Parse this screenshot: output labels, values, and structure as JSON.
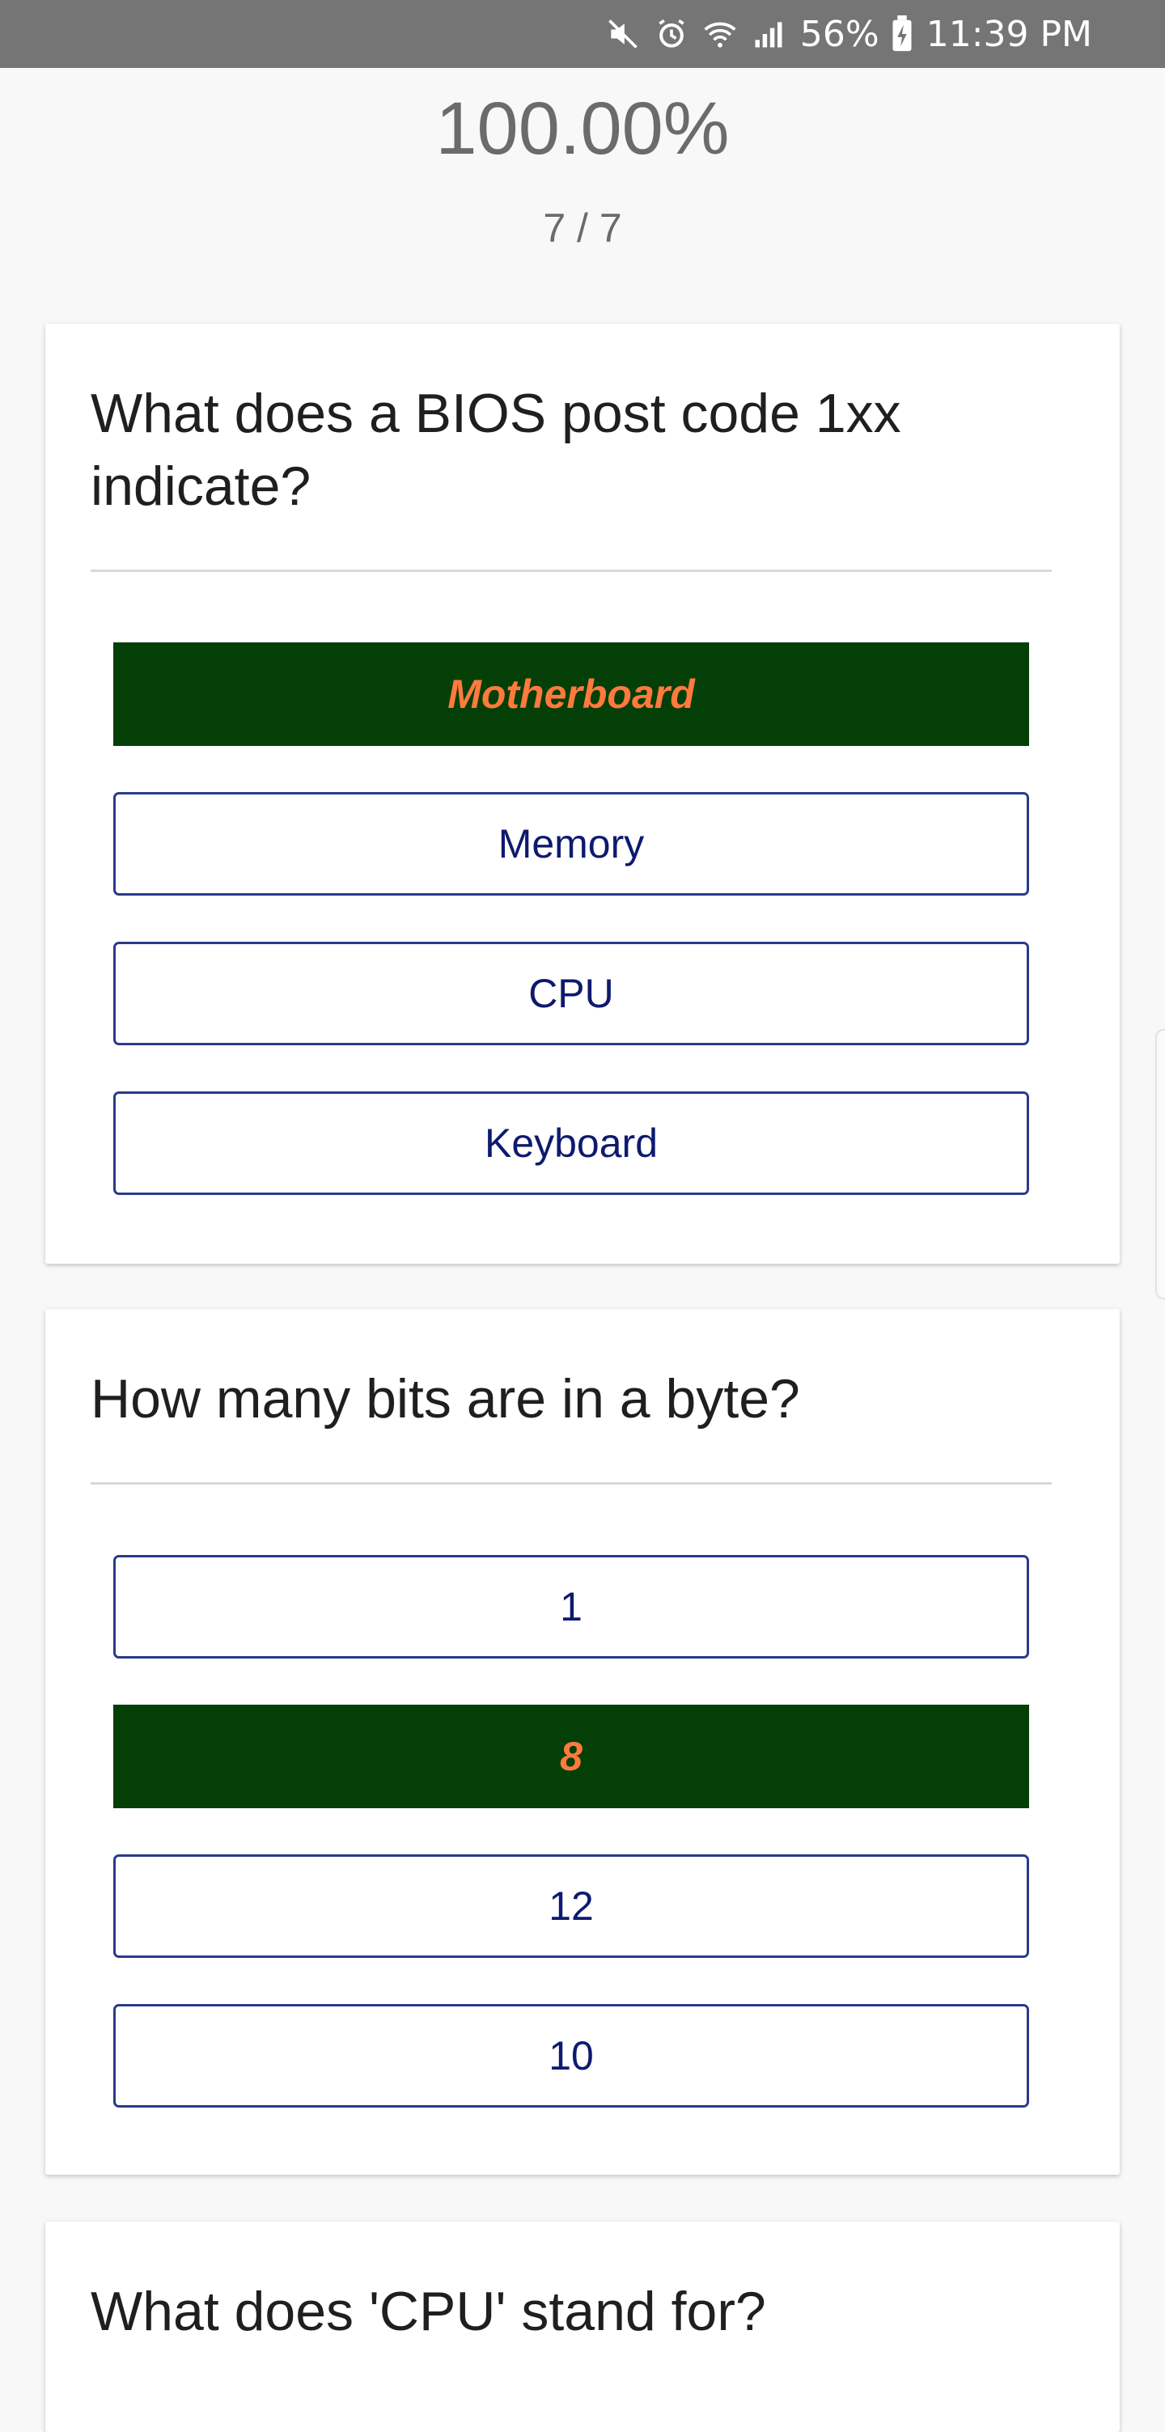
{
  "status_bar": {
    "icons": [
      "mute-icon",
      "alarm-icon",
      "wifi-icon",
      "signal-icon",
      "battery-icon"
    ],
    "battery": "56%",
    "time": "11:39 PM"
  },
  "quiz": {
    "score": "100.00%",
    "progress": "7 / 7",
    "questions": [
      {
        "text": "What does a BIOS post code 1xx indicate?",
        "options": [
          "Motherboard",
          "Memory",
          "CPU",
          "Keyboard"
        ],
        "correct_index": 0
      },
      {
        "text": "How many bits are in a byte?",
        "options": [
          "1",
          "8",
          "12",
          "10"
        ],
        "correct_index": 1
      },
      {
        "text": "What does 'CPU' stand for?"
      }
    ]
  },
  "colors": {
    "status_bar": "#757575",
    "correct_bg": "#053f08",
    "correct_text": "#ff7a3c",
    "option_border": "#2b3a8c",
    "option_text": "#0e1a6e"
  }
}
